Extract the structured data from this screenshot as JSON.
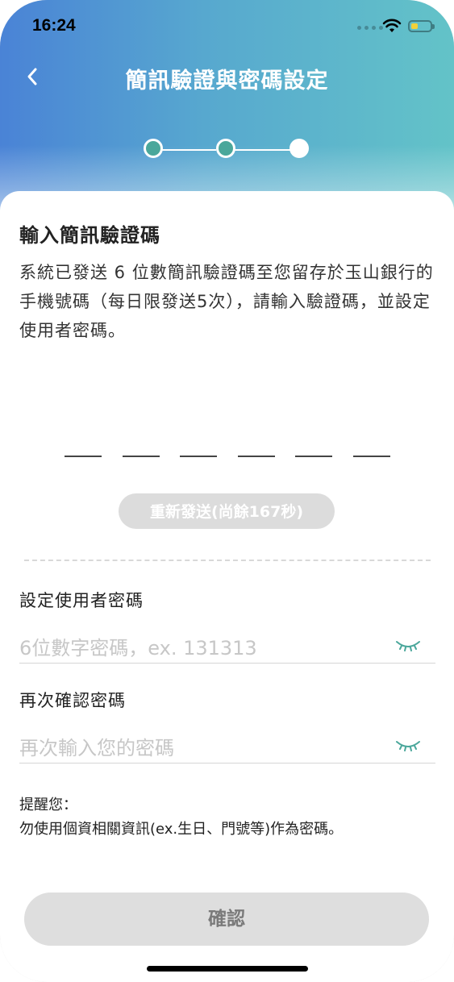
{
  "status_bar": {
    "time": "16:24"
  },
  "header": {
    "title": "簡訊驗證與密碼設定",
    "steps": [
      "done",
      "done",
      "current"
    ]
  },
  "sms": {
    "heading": "輸入簡訊驗證碼",
    "description": "系統已發送 6 位數簡訊驗證碼至您留存於玉山銀行的手機號碼（每日限發送5次），請輸入驗證碼，並設定使用者密碼。",
    "resend_label": "重新發送(尚餘167秒)"
  },
  "password": {
    "label": "設定使用者密碼",
    "placeholder": "6位數字密碼，ex. 131313"
  },
  "confirm_password": {
    "label": "再次確認密碼",
    "placeholder": "再次輸入您的密碼"
  },
  "reminder": {
    "title": "提醒您：",
    "text": "勿使用個資相關資訊(ex.生日、門號等)作為密碼。"
  },
  "confirm_button": "確認",
  "colors": {
    "accent": "#4aa79b",
    "header_start": "#4a83d6",
    "header_end": "#63c3c8"
  }
}
